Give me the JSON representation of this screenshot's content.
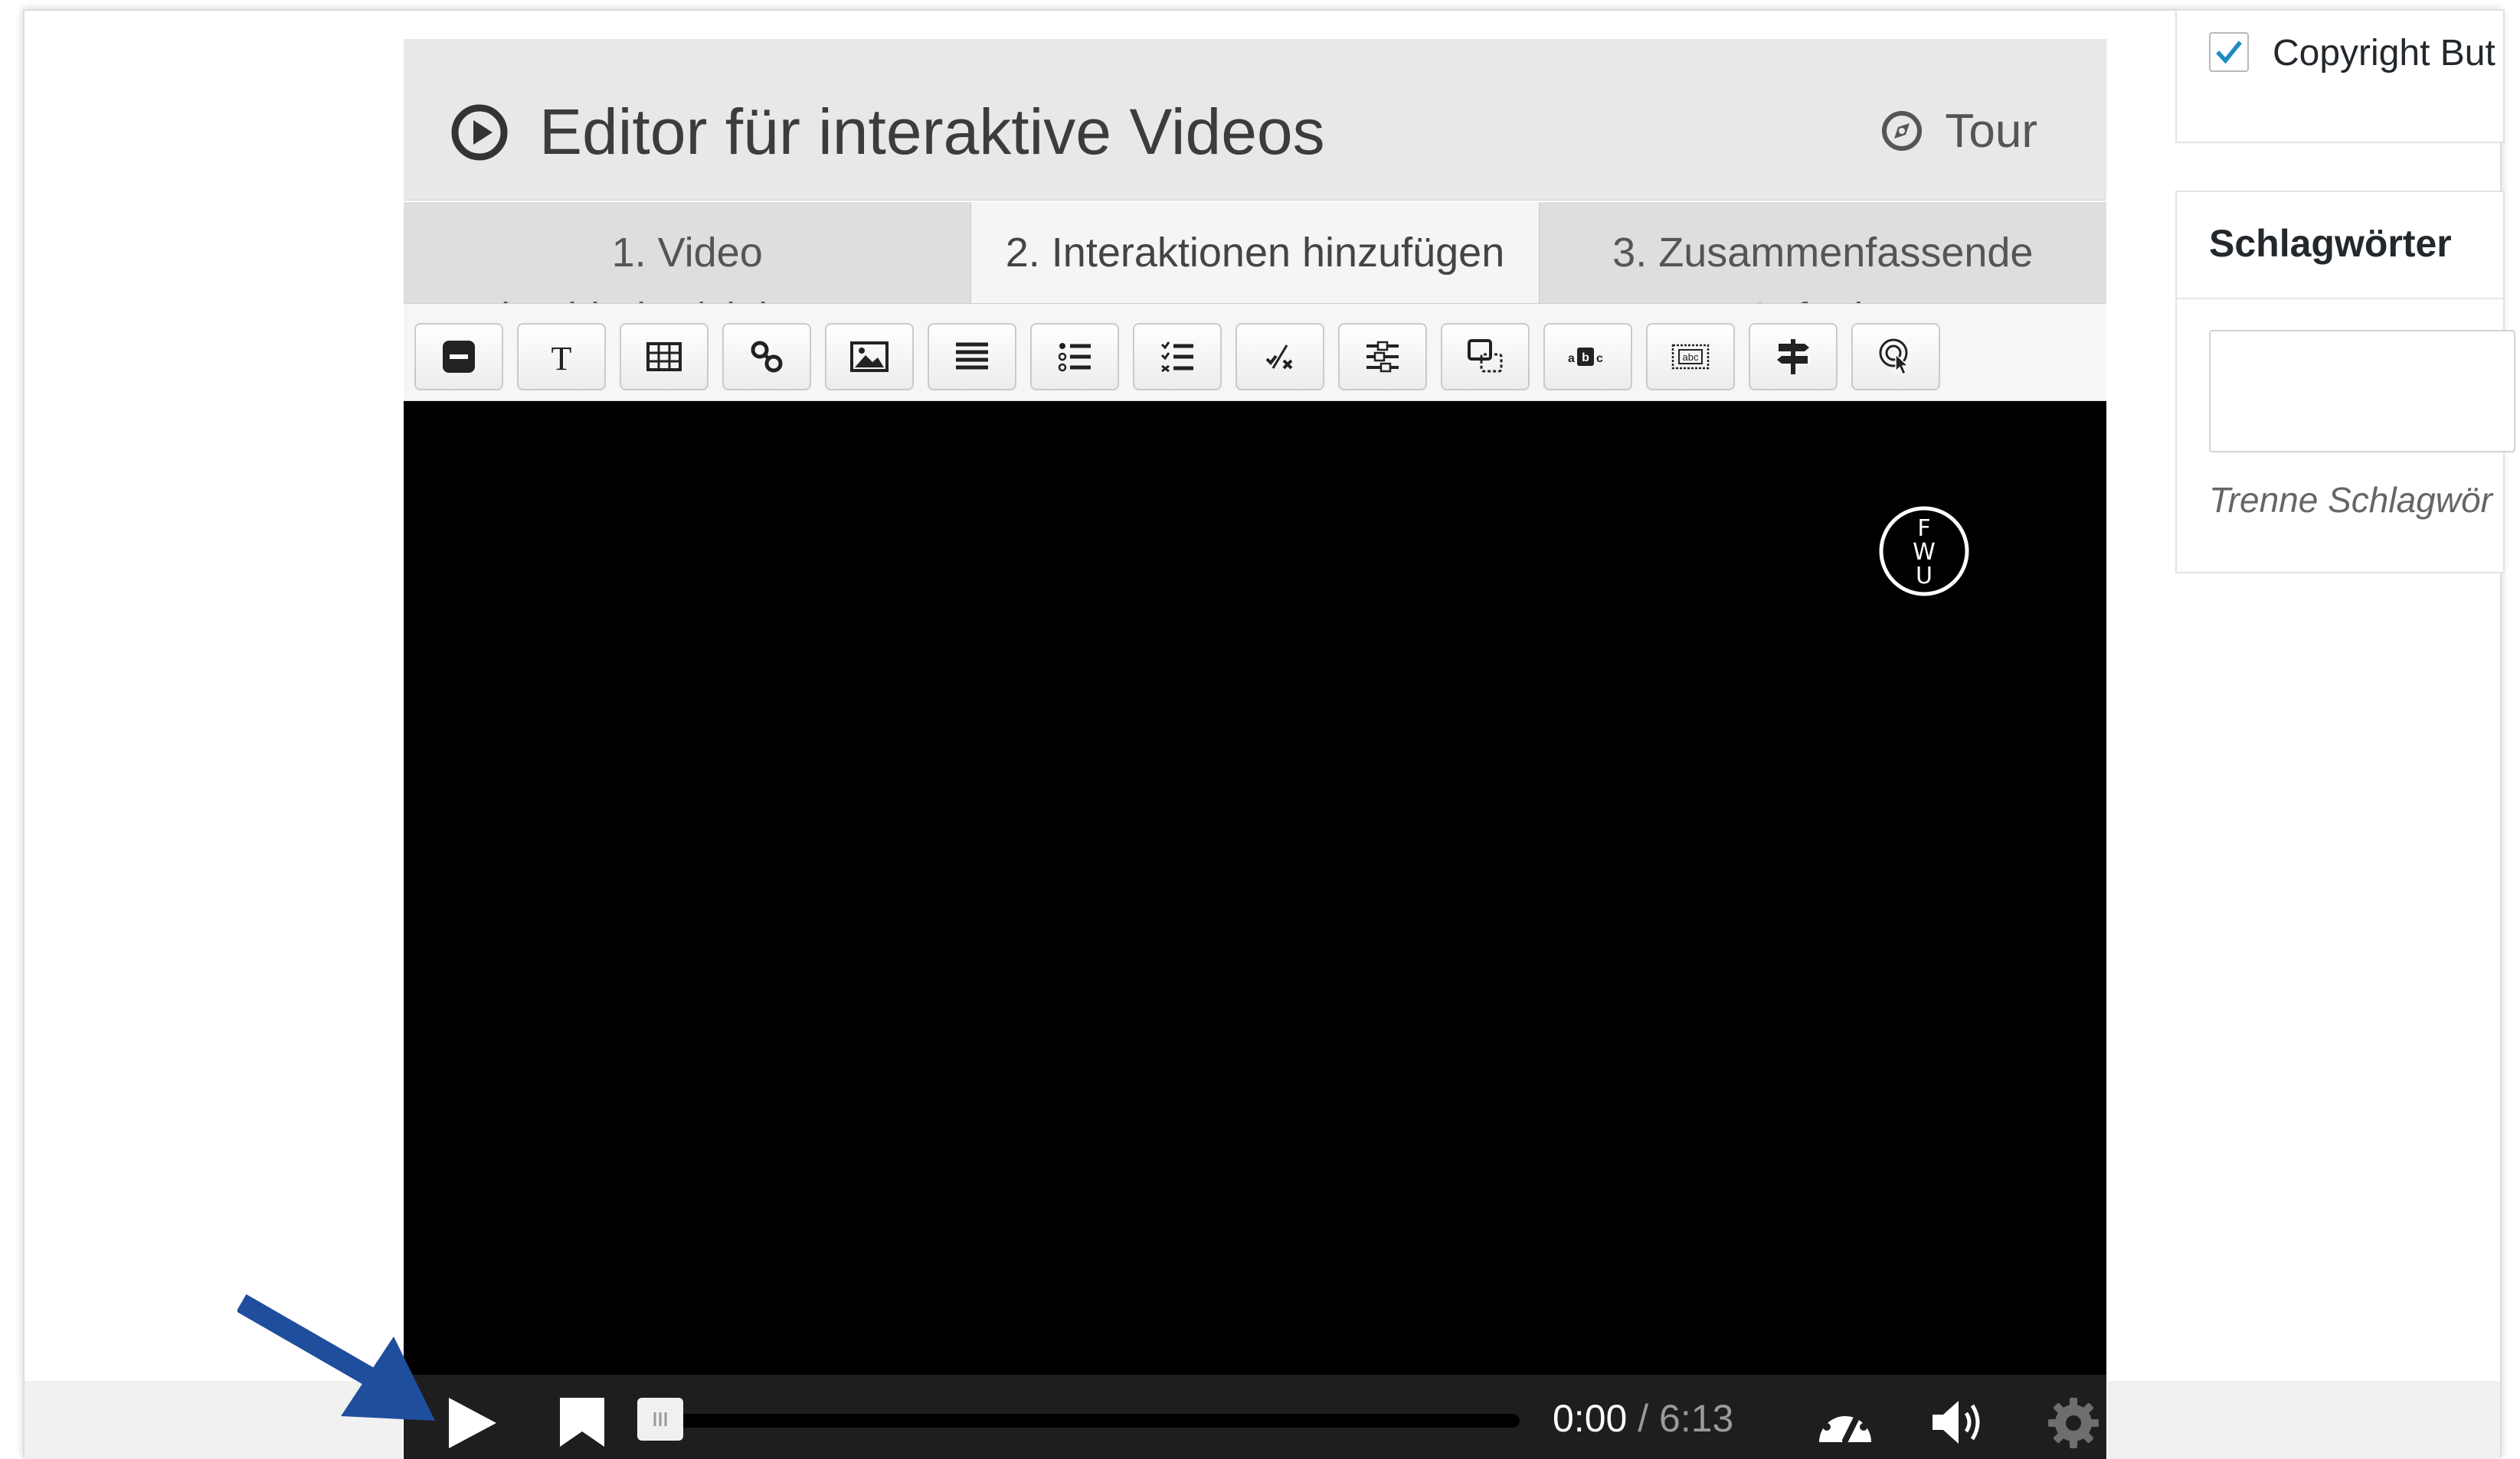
{
  "editor": {
    "title": "Editor für interaktive Videos",
    "tour_label": "Tour",
    "tabs": [
      {
        "label": "1. Video",
        "sub": "hochladen/einbetten"
      },
      {
        "label": "2. Interaktionen hinzufügen",
        "sub": ""
      },
      {
        "label": "3. Zusammenfassende",
        "sub": "Aufgabe"
      }
    ],
    "toolbar_icons": [
      "label-icon",
      "text-icon",
      "table-icon",
      "link-icon",
      "image-icon",
      "statements-icon",
      "single-choice-icon",
      "multiple-choice-icon",
      "true-false-icon",
      "drag-text-icon",
      "drag-and-drop-icon",
      "mark-words-icon",
      "fill-blanks-icon",
      "crossroads-icon",
      "navigation-hotspot-icon"
    ]
  },
  "video": {
    "logo_letters": [
      "F",
      "W",
      "U"
    ],
    "current_time": "0:00",
    "separator": "/",
    "duration": "6:13",
    "progress": 0
  },
  "sidebar": {
    "copyright": {
      "label": "Copyright But",
      "checked": true
    },
    "tags": {
      "title": "Schlagwörter",
      "hint": "Trenne Schlagwör"
    }
  },
  "colors": {
    "header_bg": "#e8e8e8",
    "video_bg": "#000000",
    "controls_bg": "#1e1e1e",
    "arrow": "#1f4e9c"
  }
}
